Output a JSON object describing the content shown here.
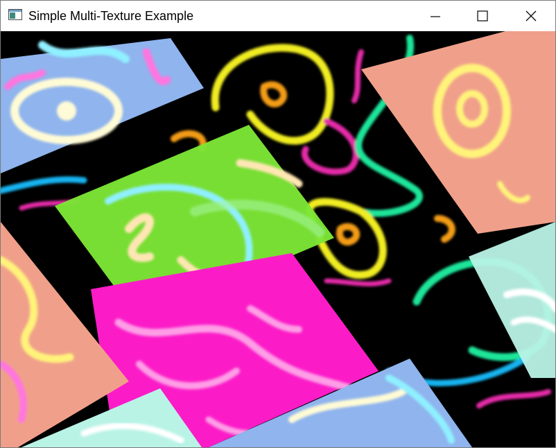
{
  "window": {
    "title": "Simple Multi-Texture Example",
    "app_icon": "app-window-icon",
    "controls": {
      "minimize_icon": "minimize-icon",
      "maximize_icon": "maximize-icon",
      "close_icon": "close-icon"
    }
  },
  "colors": {
    "title_text": "#000000",
    "scene_background": "#000000",
    "quad_green": "#7ce535",
    "quad_magenta": "#fb1cc8",
    "quad_salmon": "#f0a08a",
    "quad_blue": "#8fb4ee",
    "quad_mint": "#b9f3e6",
    "stroke_yellow": "#f0ec24",
    "stroke_green": "#1de59a",
    "stroke_cyan": "#19b4f0",
    "stroke_magenta": "#e52aa8",
    "stroke_orange": "#f29b14"
  }
}
